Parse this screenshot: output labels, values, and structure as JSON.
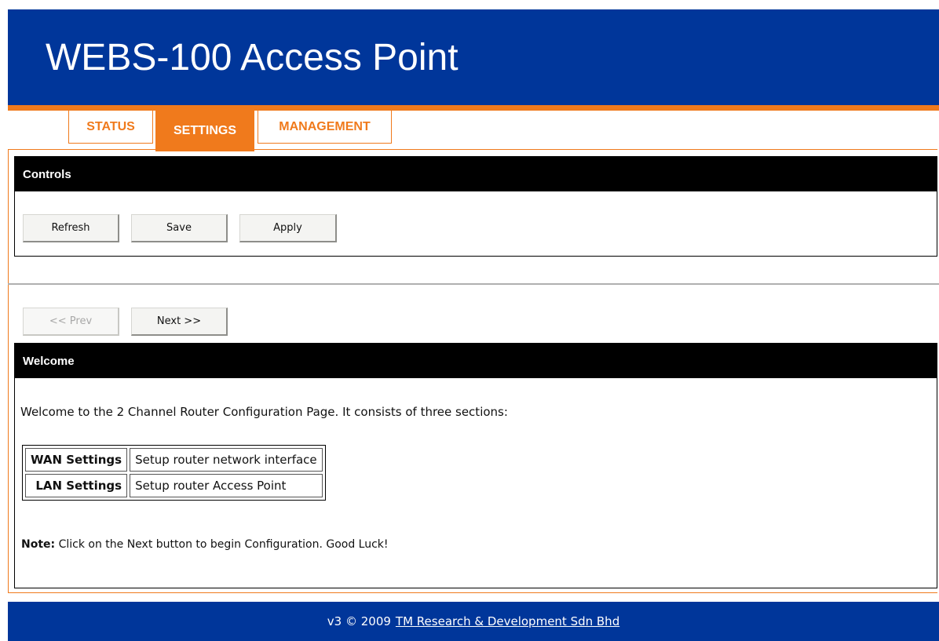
{
  "header": {
    "title": "WEBS-100 Access Point"
  },
  "tabs": [
    {
      "label": "STATUS",
      "active": false
    },
    {
      "label": "SETTINGS",
      "active": true
    },
    {
      "label": "MANAGEMENT",
      "active": false
    }
  ],
  "controls": {
    "title": "Controls",
    "buttons": {
      "refresh": "Refresh",
      "save": "Save",
      "apply": "Apply"
    }
  },
  "nav": {
    "prev": "<< Prev",
    "next": "Next >>"
  },
  "welcome": {
    "title": "Welcome",
    "intro": "Welcome to the 2 Channel Router Configuration Page. It consists of three sections:",
    "sections": [
      {
        "name": "WAN Settings",
        "description": "Setup router network interface"
      },
      {
        "name": "LAN Settings",
        "description": "Setup router Access Point"
      }
    ],
    "note_label": "Note:",
    "note_text": " Click on the Next button to begin Configuration. Good Luck!"
  },
  "footer": {
    "prefix": "v3 © 2009",
    "link": "TM Research & Development Sdn Bhd"
  },
  "colors": {
    "brand_blue": "#00369a",
    "accent_orange": "#f07a1c"
  }
}
